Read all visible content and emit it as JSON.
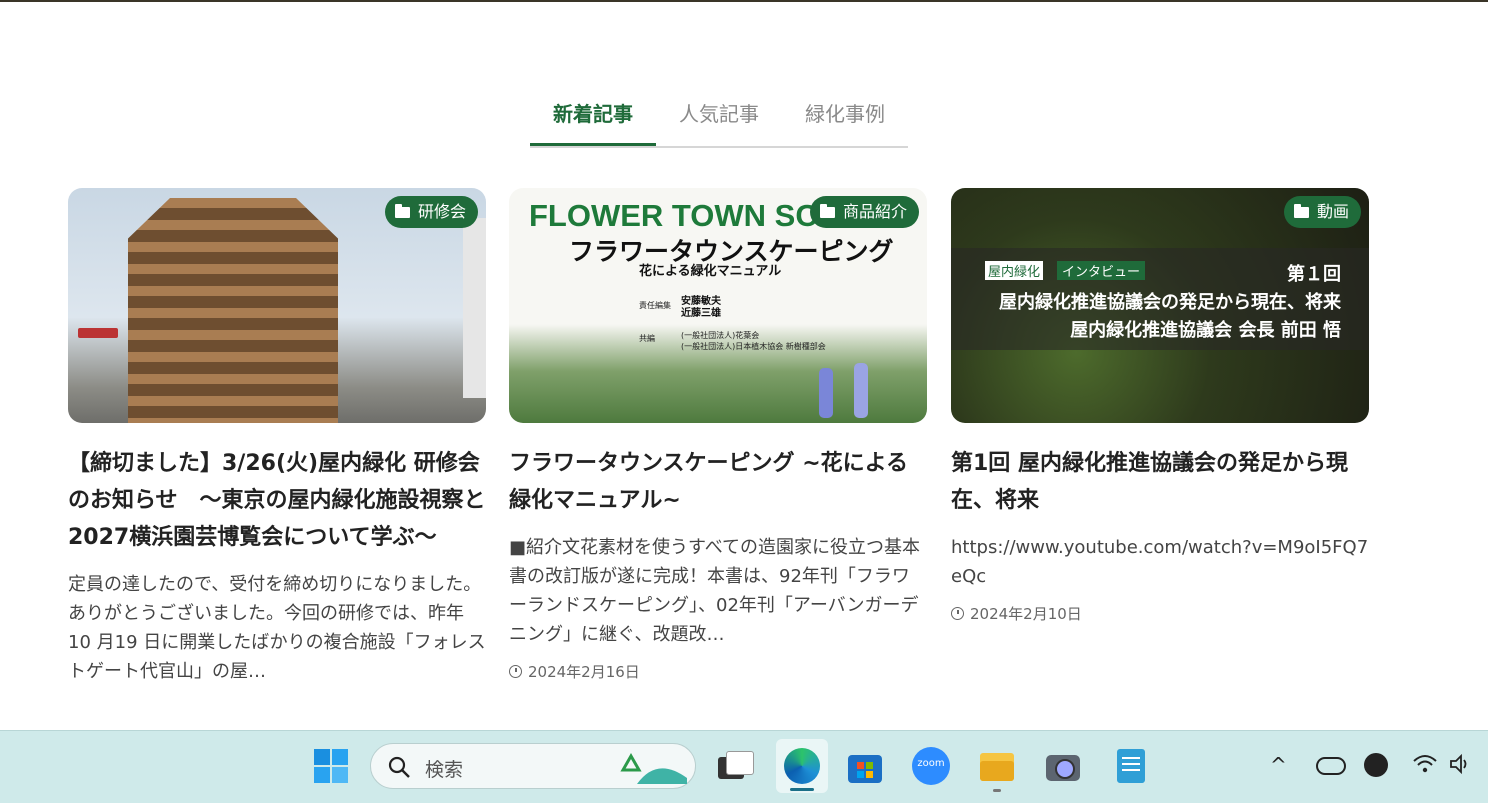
{
  "tabs": [
    {
      "label": "新着記事",
      "active": true
    },
    {
      "label": "人気記事",
      "active": false
    },
    {
      "label": "緑化事例",
      "active": false
    }
  ],
  "articles": [
    {
      "category": "研修会",
      "title": "【締切ました】3/26(火)屋内緑化 研修会のお知らせ　～東京の屋内緑化施設視察と2027横浜園芸博覧会について学ぶ～",
      "excerpt": "定員の達したので、受付を締め切りになりました。ありがとうございました。今回の研修では、昨年10 月19 日に開業したばかりの複合施設「フォレストゲート代官山」の屋…",
      "date": ""
    },
    {
      "category": "商品紹介",
      "title": "フラワータウンスケーピング ~花による緑化マニュアル~",
      "excerpt": "■紹介文花素材を使うすべての造園家に役立つ基本書の改訂版が遂に完成！本書は、92年刊「フラワーランドスケーピング」、02年刊「アーバンガーデニング」に継ぐ、改題改…",
      "date": "2024年2月16日",
      "thumb": {
        "heading": "FLOWER TOWN SCA",
        "subheading": "フラワータウンスケーピング",
        "subtitle": "花による緑化マニュアル",
        "editor_label": "責任編集",
        "editors": "安藤敏夫\n近藤三雄",
        "coop_label": "共編",
        "coop": "(一般社団法人)花葉会\n(一般社団法人)日本植木協会 新樹種部会"
      }
    },
    {
      "category": "動画",
      "title": "第1回 屋内緑化推進協議会の発足から現在、将来",
      "excerpt": "https://www.youtube.com/watch?v=M9oI5FQ7eQc",
      "date": "2024年2月10日",
      "thumb": {
        "tag1": "屋内緑化",
        "tag2": "インタビュー",
        "episode": "第１回",
        "line1": "屋内緑化推進協議会の発足から現在、将来",
        "line2": "屋内緑化推進協議会 会長 前田 悟"
      }
    }
  ],
  "taskbar": {
    "search_placeholder": "検索",
    "apps": [
      "windows-start",
      "task-view",
      "edge",
      "microsoft-store",
      "zoom",
      "file-explorer",
      "camera",
      "notepad"
    ],
    "zoom_label": "zoom",
    "colors": {
      "background": "#cfeaea",
      "accent": "#1f6b3a"
    }
  }
}
